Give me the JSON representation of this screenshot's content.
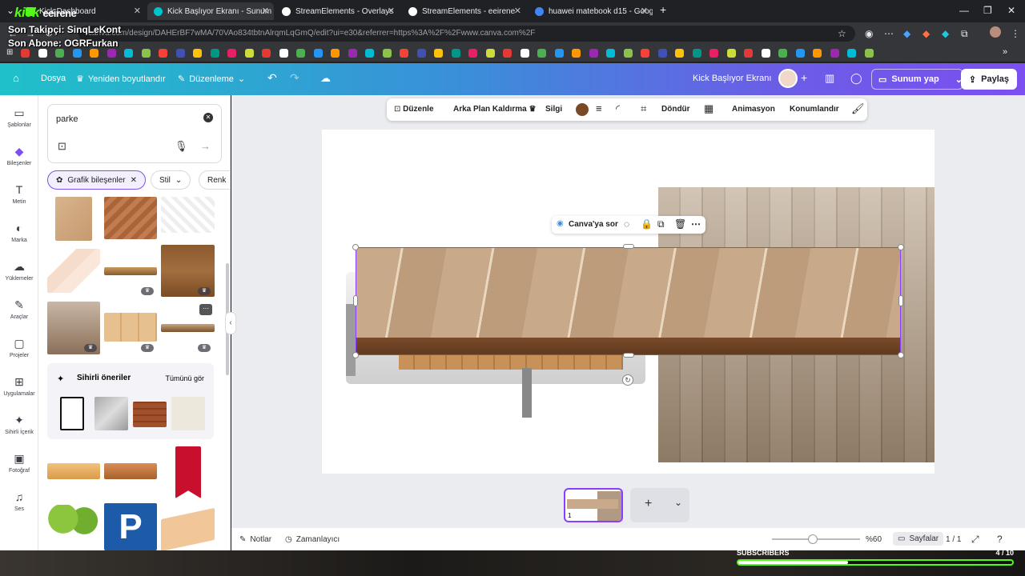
{
  "browser": {
    "tabs": [
      {
        "title": "Kick Dashboard",
        "color": "#53fc18"
      },
      {
        "title": "Kick Başlıyor Ekranı - Sunum",
        "color": "#00c4cc"
      },
      {
        "title": "StreamElements - Overlays",
        "color": "#ffffff"
      },
      {
        "title": "StreamElements - eeirene",
        "color": "#ffffff"
      },
      {
        "title": "huawei matebook d15 - Google",
        "color": "#4285f4"
      }
    ],
    "new_tab": "+",
    "url": "canva.com/design/DAHErBF7wMA/70VAo834tbtnAlrqmLqGmQ/edit?ui=e30&referrer=https%3A%2F%2Fwww.canva.com%2F"
  },
  "stream_overlay": {
    "brand": "kick",
    "channel": "eeirene",
    "last_follower": "Son Takipçi: SinqLeKont",
    "last_sub": "Son Abone: OGRFurkan",
    "subscribers_label": "SUBSCRIBERS",
    "subscribers_count": "4 / 10",
    "subscribers_progress": 0.4
  },
  "toolbar": {
    "file": "Dosya",
    "resize": "Yeniden boyutlandır",
    "editing": "Düzenleme",
    "doc_title": "Kick Başlıyor Ekranı",
    "present": "Sunum yap",
    "share": "Paylaş"
  },
  "rail": [
    {
      "label": "Şablonlar",
      "icon": "▭"
    },
    {
      "label": "Bileşenler",
      "icon": "◆"
    },
    {
      "label": "Metin",
      "icon": "T"
    },
    {
      "label": "Marka",
      "icon": "◐"
    },
    {
      "label": "Yüklemeler",
      "icon": "☁"
    },
    {
      "label": "Araçlar",
      "icon": "✎"
    },
    {
      "label": "Projeler",
      "icon": "▢"
    },
    {
      "label": "Uygulamalar",
      "icon": "⊞"
    },
    {
      "label": "Sihirli İçerik",
      "icon": "✦"
    },
    {
      "label": "Fotoğraf",
      "icon": "▣"
    },
    {
      "label": "Ses",
      "icon": "♫"
    }
  ],
  "panel": {
    "search_value": "parke",
    "chips": [
      "Grafik bileşenler",
      "Stil",
      "Renk"
    ],
    "magic_title": "Sihirli öneriler",
    "see_all": "Tümünü gör"
  },
  "context_toolbar": {
    "edit": "Düzenle",
    "bg_remove": "Arka Plan Kaldırma",
    "eraser": "Silgi",
    "color": "#7a4a26",
    "rotate": "Döndür",
    "animation": "Animasyon",
    "position": "Konumlandır"
  },
  "float_toolbar": {
    "ask": "Canva'ya sor"
  },
  "bottom": {
    "notes": "Notlar",
    "timer": "Zamanlayıcı",
    "zoom": "%60",
    "pages": "Sayfalar",
    "page_count": "1 / 1",
    "page_number": "1"
  }
}
